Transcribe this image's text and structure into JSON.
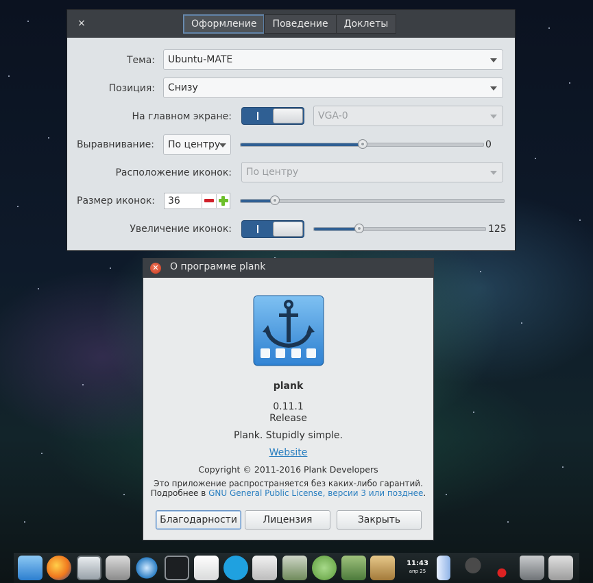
{
  "prefs": {
    "close_symbol": "×",
    "tabs": [
      {
        "label": "Оформление",
        "active": true
      },
      {
        "label": "Поведение",
        "active": false
      },
      {
        "label": "Доклеты",
        "active": false
      }
    ],
    "theme": {
      "label": "Тема:",
      "value": "Ubuntu-MATE"
    },
    "position": {
      "label": "Позиция:",
      "value": "Снизу"
    },
    "primary_display": {
      "label": "На главном экране:",
      "switch_on": true,
      "monitor": "VGA-0"
    },
    "alignment": {
      "label": "Выравнивание:",
      "value": "По центру",
      "offset": "0"
    },
    "items_alignment": {
      "label": "Расположение иконок:",
      "value": "По центру"
    },
    "icon_size": {
      "label": "Размер иконок:",
      "value": "36"
    },
    "zoom": {
      "label": "Увеличение иконок:",
      "switch_on": true,
      "value": "125"
    }
  },
  "about": {
    "title": "О программе plank",
    "app_name": "plank",
    "version": "0.11.1",
    "release": "Release",
    "tagline": "Plank. Stupidly simple.",
    "website": "Website",
    "copyright": "Copyright © 2011-2016 Plank Developers",
    "warranty_line": "Это приложение распространяется без каких-либо гарантий.",
    "license_prefix": "Подробнее в ",
    "license_link": "GNU General Public License, версии 3 или позднее",
    "license_suffix": ".",
    "buttons": {
      "credits": "Благодарности",
      "license": "Лицензия",
      "close": "Закрыть"
    }
  },
  "dock": {
    "clock_time": "11:43",
    "clock_date": "апр 25",
    "items": [
      "plank-icon",
      "firefox-icon",
      "file-manager-icon",
      "camera-icon",
      "blender-icon",
      "terminal-icon",
      "text-editor-icon",
      "skype-icon",
      "task-checker-icon",
      "system-tools-icon",
      "ubuntu-mate-icon",
      "window-manager-icon",
      "archive-icon",
      "clock-icon",
      "ruler-icon",
      "solitaire-icon",
      "scissors-icon",
      "trash-icon",
      "screenshot-icon"
    ]
  },
  "colors": {
    "accent": "#2f5f93",
    "link": "#2a7fc0",
    "title_bar": "#3b3f44"
  }
}
